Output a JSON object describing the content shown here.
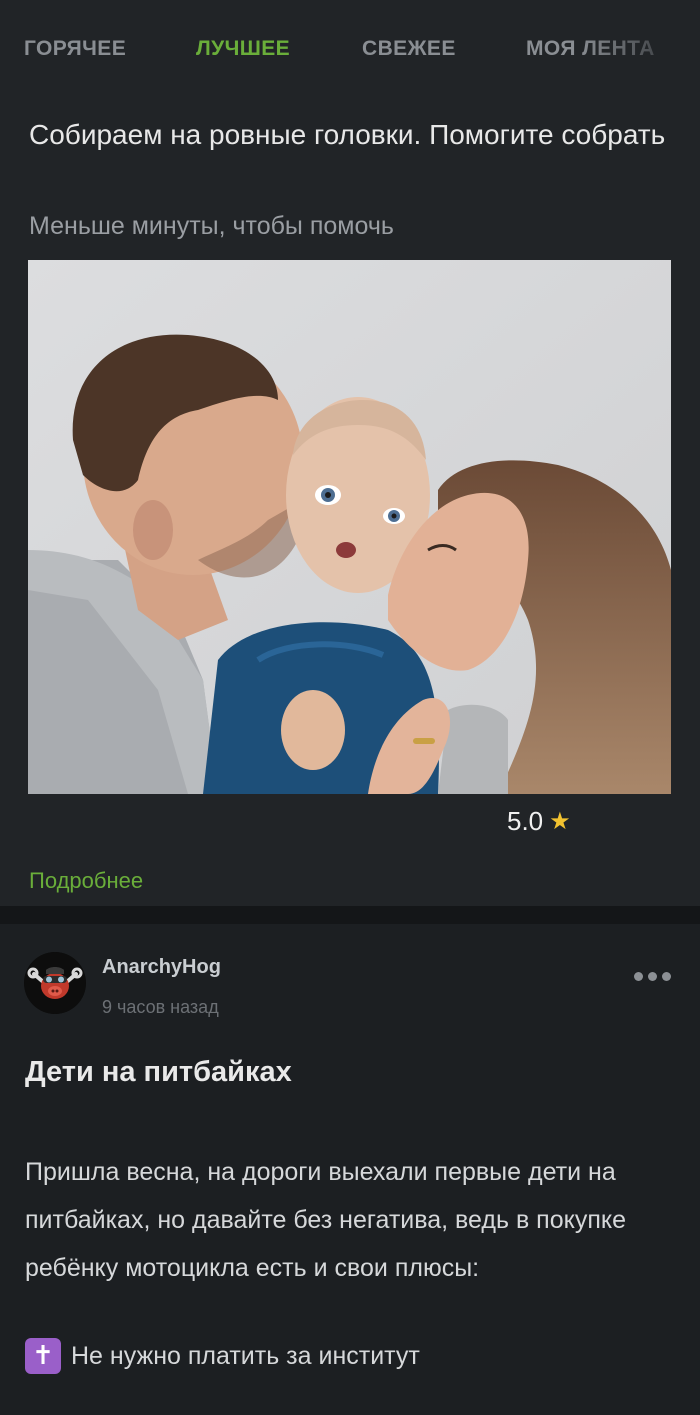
{
  "tabs": [
    {
      "label": "ГОРЯЧЕЕ",
      "active": false
    },
    {
      "label": "ЛУЧШЕЕ",
      "active": true
    },
    {
      "label": "СВЕЖЕЕ",
      "active": false
    },
    {
      "label": "МОЯ ЛЕНТА",
      "active": false
    }
  ],
  "promo": {
    "title": "Собираем на ровные головки. Помогите собрать",
    "subtitle": "Меньше минуты, чтобы помочь",
    "photo_icon": "family-photo",
    "rating": "5.0",
    "rating_icon": "star-icon",
    "more_link": "Подробнее"
  },
  "post": {
    "author": "AnarchyHog",
    "time": "9 часов назад",
    "title": "Дети на питбайках",
    "body": "Пришла весна, на дороги выехали первые дети на питбайках, но давайте без негатива, ведь в покупке ребёнку мотоцикла есть и свои плюсы:",
    "list": [
      {
        "icon": "latin-cross-icon",
        "text": "Не нужно платить за институт"
      }
    ]
  },
  "colors": {
    "accent": "#6aae3a",
    "background": "#1c1f22",
    "card": "#212427",
    "star": "#f2c230"
  }
}
